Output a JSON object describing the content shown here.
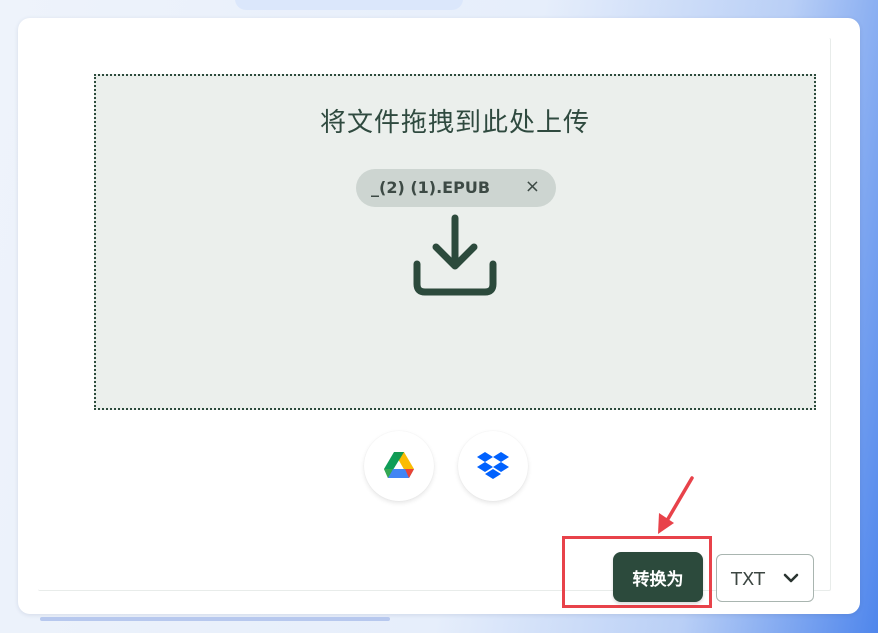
{
  "upload": {
    "drop_text": "将文件拖拽到此处上传",
    "file_chip": {
      "name": "_(2) (1).EPUB",
      "remove_glyph": "×"
    },
    "icon": "download-icon"
  },
  "cloud_sources": [
    {
      "name": "google-drive-icon"
    },
    {
      "name": "dropbox-icon"
    }
  ],
  "actions": {
    "convert_label": "转换为",
    "format_value": "TXT"
  },
  "colors": {
    "primary": "#2c4a3c",
    "dropzone_bg": "#ebefec",
    "annotation": "#e8424a"
  }
}
